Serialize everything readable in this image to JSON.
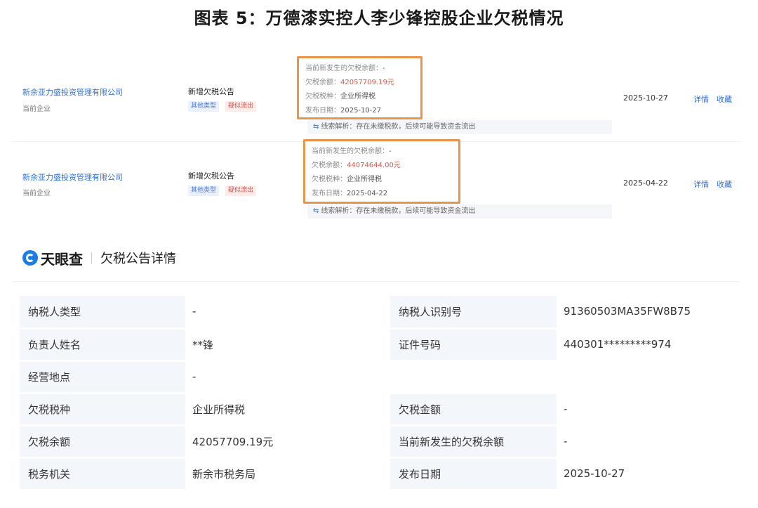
{
  "figure_title": "图表 5：万德漆实控人李少锋控股企业欠税情况",
  "records": [
    {
      "company": "新余亚力盛投资管理有限公司",
      "company_role": "当前企业",
      "announcement": "新增欠税公告",
      "tags": [
        "其他类型",
        "疑似流出"
      ],
      "new_balance_label": "当前新发生的欠税余额：",
      "new_balance_value": "-",
      "balance_label": "欠税余额：",
      "balance_value": "42057709.19元",
      "tax_type_label": "欠税税种：",
      "tax_type_value": "企业所得税",
      "publish_label": "发布日期：",
      "publish_value": "2025-10-27",
      "clue_label": "线索解析：",
      "clue_text": "存在未缴税款，后续可能导致资金流出",
      "date": "2025-10-27",
      "detail_link": "详情",
      "favorite_link": "收藏"
    },
    {
      "company": "新余亚力盛投资管理有限公司",
      "company_role": "当前企业",
      "announcement": "新增欠税公告",
      "tags": [
        "其他类型",
        "疑似流出"
      ],
      "new_balance_label": "当前新发生的欠税余额：",
      "new_balance_value": "-",
      "balance_label": "欠税余额：",
      "balance_value": "44074644.00元",
      "tax_type_label": "欠税税种：",
      "tax_type_value": "企业所得税",
      "publish_label": "发布日期：",
      "publish_value": "2025-04-22",
      "clue_label": "线索解析：",
      "clue_text": "存在未缴税款，后续可能导致资金流出",
      "date": "2025-04-22",
      "detail_link": "详情",
      "favorite_link": "收藏"
    }
  ],
  "brand": {
    "name": "天眼查",
    "subtitle": "欠税公告详情",
    "logo_icon": "tianyancha-logo-icon"
  },
  "detail_table": [
    {
      "k1": "纳税人类型",
      "v1": "-",
      "k2": "纳税人识别号",
      "v2": "91360503MA35FW8B75"
    },
    {
      "k1": "负责人姓名",
      "v1": "**锋",
      "k2": "证件号码",
      "v2": "440301*********974"
    },
    {
      "k1": "经营地点",
      "v1": "-"
    },
    {
      "k1": "欠税税种",
      "v1": "企业所得税",
      "k2": "欠税金额",
      "v2": "-"
    },
    {
      "k1": "欠税余额",
      "v1": "42057709.19元",
      "k2": "当前新发生的欠税余额",
      "v2": "-"
    },
    {
      "k1": "税务机关",
      "v1": "新余市税务局",
      "k2": "发布日期",
      "v2": "2025-10-27"
    }
  ],
  "colors": {
    "highlight_box": "#e6954b",
    "link_blue": "#2f6fd6",
    "amount_red": "#e05545"
  }
}
